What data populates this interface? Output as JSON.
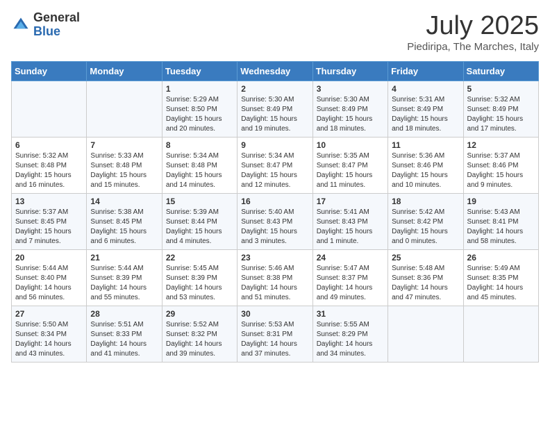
{
  "header": {
    "logo_general": "General",
    "logo_blue": "Blue",
    "month": "July 2025",
    "location": "Piediripa, The Marches, Italy"
  },
  "days_of_week": [
    "Sunday",
    "Monday",
    "Tuesday",
    "Wednesday",
    "Thursday",
    "Friday",
    "Saturday"
  ],
  "weeks": [
    [
      {
        "day": "",
        "info": ""
      },
      {
        "day": "",
        "info": ""
      },
      {
        "day": "1",
        "info": "Sunrise: 5:29 AM\nSunset: 8:50 PM\nDaylight: 15 hours\nand 20 minutes."
      },
      {
        "day": "2",
        "info": "Sunrise: 5:30 AM\nSunset: 8:49 PM\nDaylight: 15 hours\nand 19 minutes."
      },
      {
        "day": "3",
        "info": "Sunrise: 5:30 AM\nSunset: 8:49 PM\nDaylight: 15 hours\nand 18 minutes."
      },
      {
        "day": "4",
        "info": "Sunrise: 5:31 AM\nSunset: 8:49 PM\nDaylight: 15 hours\nand 18 minutes."
      },
      {
        "day": "5",
        "info": "Sunrise: 5:32 AM\nSunset: 8:49 PM\nDaylight: 15 hours\nand 17 minutes."
      }
    ],
    [
      {
        "day": "6",
        "info": "Sunrise: 5:32 AM\nSunset: 8:48 PM\nDaylight: 15 hours\nand 16 minutes."
      },
      {
        "day": "7",
        "info": "Sunrise: 5:33 AM\nSunset: 8:48 PM\nDaylight: 15 hours\nand 15 minutes."
      },
      {
        "day": "8",
        "info": "Sunrise: 5:34 AM\nSunset: 8:48 PM\nDaylight: 15 hours\nand 14 minutes."
      },
      {
        "day": "9",
        "info": "Sunrise: 5:34 AM\nSunset: 8:47 PM\nDaylight: 15 hours\nand 12 minutes."
      },
      {
        "day": "10",
        "info": "Sunrise: 5:35 AM\nSunset: 8:47 PM\nDaylight: 15 hours\nand 11 minutes."
      },
      {
        "day": "11",
        "info": "Sunrise: 5:36 AM\nSunset: 8:46 PM\nDaylight: 15 hours\nand 10 minutes."
      },
      {
        "day": "12",
        "info": "Sunrise: 5:37 AM\nSunset: 8:46 PM\nDaylight: 15 hours\nand 9 minutes."
      }
    ],
    [
      {
        "day": "13",
        "info": "Sunrise: 5:37 AM\nSunset: 8:45 PM\nDaylight: 15 hours\nand 7 minutes."
      },
      {
        "day": "14",
        "info": "Sunrise: 5:38 AM\nSunset: 8:45 PM\nDaylight: 15 hours\nand 6 minutes."
      },
      {
        "day": "15",
        "info": "Sunrise: 5:39 AM\nSunset: 8:44 PM\nDaylight: 15 hours\nand 4 minutes."
      },
      {
        "day": "16",
        "info": "Sunrise: 5:40 AM\nSunset: 8:43 PM\nDaylight: 15 hours\nand 3 minutes."
      },
      {
        "day": "17",
        "info": "Sunrise: 5:41 AM\nSunset: 8:43 PM\nDaylight: 15 hours\nand 1 minute."
      },
      {
        "day": "18",
        "info": "Sunrise: 5:42 AM\nSunset: 8:42 PM\nDaylight: 15 hours\nand 0 minutes."
      },
      {
        "day": "19",
        "info": "Sunrise: 5:43 AM\nSunset: 8:41 PM\nDaylight: 14 hours\nand 58 minutes."
      }
    ],
    [
      {
        "day": "20",
        "info": "Sunrise: 5:44 AM\nSunset: 8:40 PM\nDaylight: 14 hours\nand 56 minutes."
      },
      {
        "day": "21",
        "info": "Sunrise: 5:44 AM\nSunset: 8:39 PM\nDaylight: 14 hours\nand 55 minutes."
      },
      {
        "day": "22",
        "info": "Sunrise: 5:45 AM\nSunset: 8:39 PM\nDaylight: 14 hours\nand 53 minutes."
      },
      {
        "day": "23",
        "info": "Sunrise: 5:46 AM\nSunset: 8:38 PM\nDaylight: 14 hours\nand 51 minutes."
      },
      {
        "day": "24",
        "info": "Sunrise: 5:47 AM\nSunset: 8:37 PM\nDaylight: 14 hours\nand 49 minutes."
      },
      {
        "day": "25",
        "info": "Sunrise: 5:48 AM\nSunset: 8:36 PM\nDaylight: 14 hours\nand 47 minutes."
      },
      {
        "day": "26",
        "info": "Sunrise: 5:49 AM\nSunset: 8:35 PM\nDaylight: 14 hours\nand 45 minutes."
      }
    ],
    [
      {
        "day": "27",
        "info": "Sunrise: 5:50 AM\nSunset: 8:34 PM\nDaylight: 14 hours\nand 43 minutes."
      },
      {
        "day": "28",
        "info": "Sunrise: 5:51 AM\nSunset: 8:33 PM\nDaylight: 14 hours\nand 41 minutes."
      },
      {
        "day": "29",
        "info": "Sunrise: 5:52 AM\nSunset: 8:32 PM\nDaylight: 14 hours\nand 39 minutes."
      },
      {
        "day": "30",
        "info": "Sunrise: 5:53 AM\nSunset: 8:31 PM\nDaylight: 14 hours\nand 37 minutes."
      },
      {
        "day": "31",
        "info": "Sunrise: 5:55 AM\nSunset: 8:29 PM\nDaylight: 14 hours\nand 34 minutes."
      },
      {
        "day": "",
        "info": ""
      },
      {
        "day": "",
        "info": ""
      }
    ]
  ]
}
